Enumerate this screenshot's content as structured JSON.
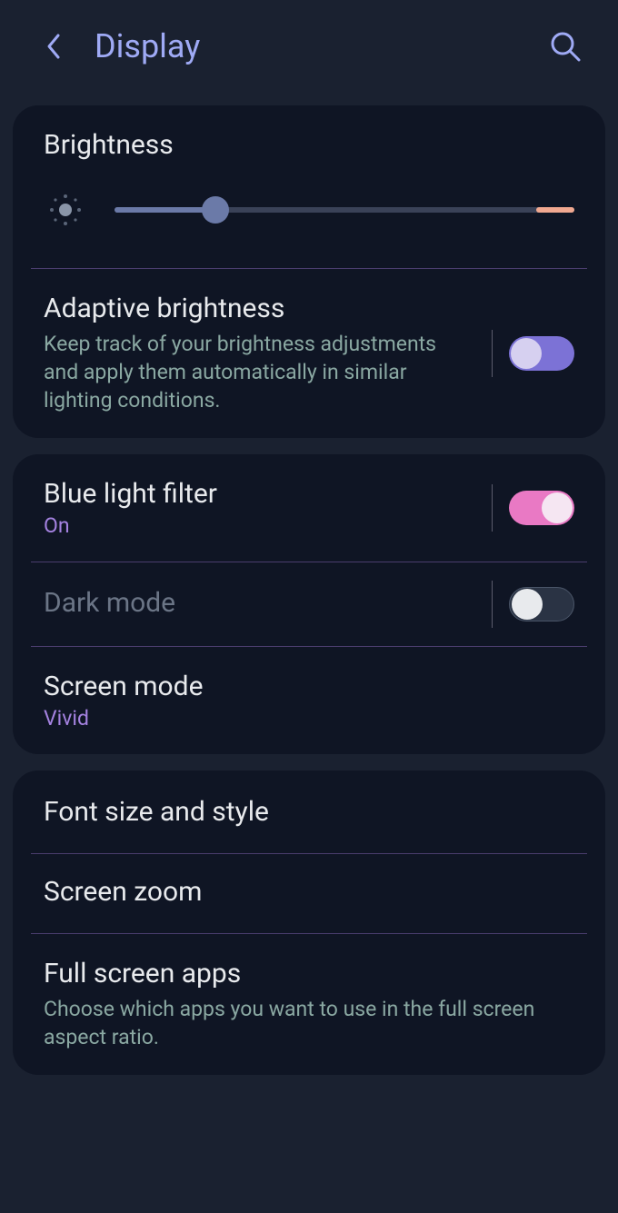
{
  "header": {
    "title": "Display"
  },
  "card1": {
    "brightness": {
      "label": "Brightness",
      "value_percent": 22
    },
    "adaptive": {
      "title": "Adaptive brightness",
      "desc": "Keep track of your brightness adjustments and apply them automatically in similar lighting conditions.",
      "on": true
    }
  },
  "card2": {
    "bluelight": {
      "title": "Blue light filter",
      "status": "On",
      "on": true
    },
    "darkmode": {
      "title": "Dark mode",
      "on": false
    },
    "screenmode": {
      "title": "Screen mode",
      "status": "Vivid"
    }
  },
  "card3": {
    "font": {
      "title": "Font size and style"
    },
    "zoom": {
      "title": "Screen zoom"
    },
    "fullscreen": {
      "title": "Full screen apps",
      "desc": "Choose which apps you want to use in the full screen aspect ratio."
    }
  }
}
